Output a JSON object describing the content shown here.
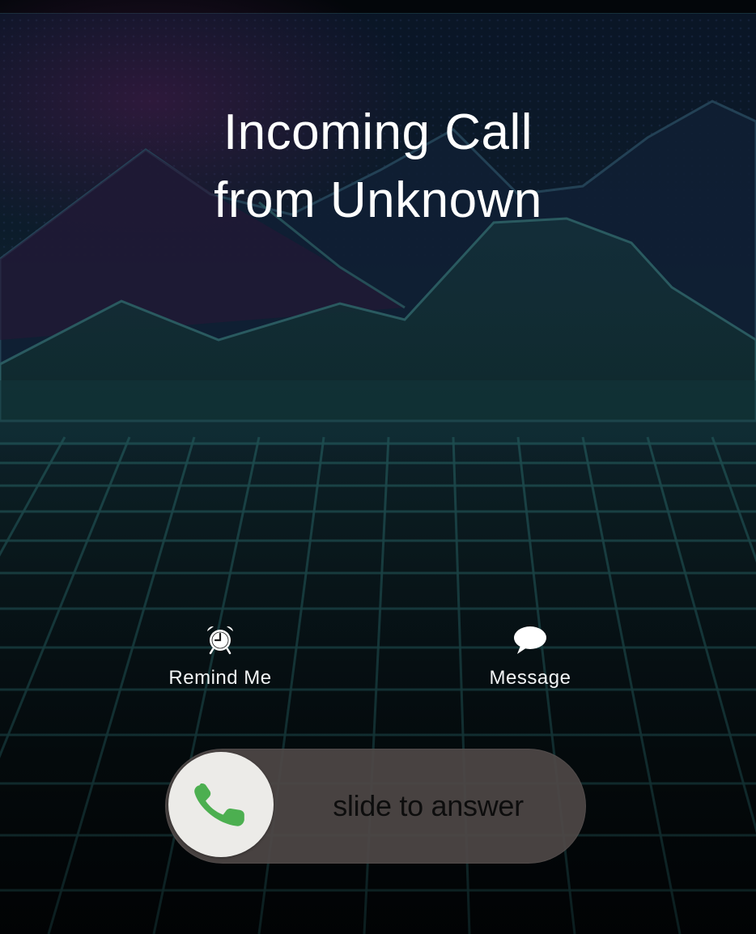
{
  "call": {
    "title_line1": "Incoming Call",
    "title_line2": "from Unknown"
  },
  "actions": {
    "remind": {
      "label": "Remind Me",
      "icon": "alarm-clock-icon"
    },
    "message": {
      "label": "Message",
      "icon": "speech-bubble-icon"
    }
  },
  "slider": {
    "text": "slide to answer",
    "icon": "phone-icon",
    "icon_color": "#4caf50"
  },
  "colors": {
    "background_top": "#0a1526",
    "grid_line": "#1e4d50",
    "mountain_line": "#2a5a60",
    "accent_purple": "#3a1a3e"
  }
}
